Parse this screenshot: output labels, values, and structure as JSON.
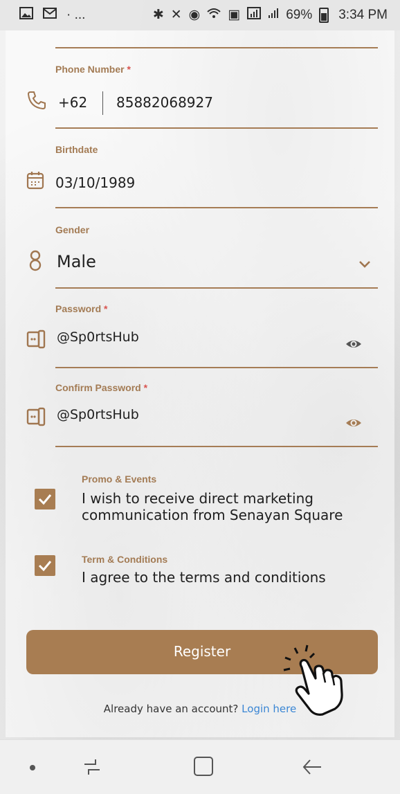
{
  "status_bar": {
    "left_icons": [
      "gallery-icon",
      "gmail-icon",
      "more-notifications"
    ],
    "dots": "· ...",
    "right_icons": [
      "bluetooth-icon",
      "mute-icon",
      "alarm-icon",
      "wifi-icon",
      "data-saver-icon",
      "lte-signal-icon",
      "signal-icon"
    ],
    "battery": "69%",
    "time": "3:34 PM"
  },
  "form": {
    "phone": {
      "label": "Phone Number",
      "required": "*",
      "prefix": "+62",
      "value": "85882068927",
      "icon": "phone-icon"
    },
    "birthdate": {
      "label": "Birthdate",
      "value": "03/10/1989",
      "icon": "calendar-icon"
    },
    "gender": {
      "label": "Gender",
      "value": "Male",
      "icon": "gender-icon"
    },
    "password": {
      "label": "Password",
      "required": "*",
      "value": "@Sp0rtsHub",
      "icon": "password-icon"
    },
    "confirm_password": {
      "label": "Confirm Password",
      "required": "*",
      "value": "@Sp0rtsHub",
      "icon": "password-icon"
    }
  },
  "promo": {
    "title": "Promo & Events",
    "line1": "I wish to receive direct marketing",
    "line2": "communication from Senayan Square",
    "checked": true
  },
  "terms": {
    "title": "Term & Conditions",
    "text": "I agree to the terms and conditions",
    "checked": true
  },
  "register_label": "Register",
  "login": {
    "prompt": "Already have an account?",
    "link": "Login here"
  },
  "colors": {
    "accent": "#a87d52",
    "link": "#3a86d4",
    "required": "#d9534f"
  }
}
